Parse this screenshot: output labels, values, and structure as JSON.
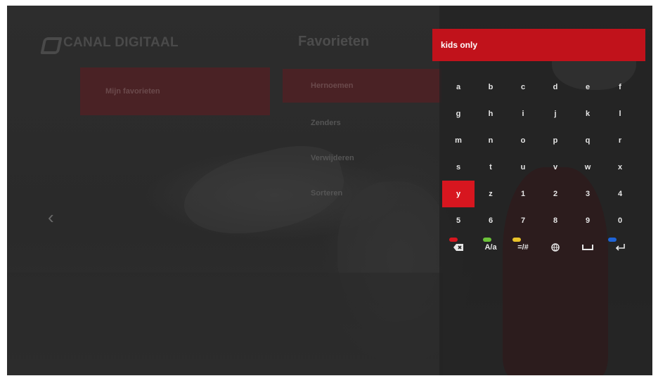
{
  "brand": {
    "name": "CANAL DIGITAAL"
  },
  "sidebar": {
    "items": [
      {
        "label": "Mijn favorieten"
      }
    ]
  },
  "section": {
    "title": "Favorieten"
  },
  "menu": {
    "items": [
      {
        "label": "Hernoemen",
        "active": true
      },
      {
        "label": "Zenders"
      },
      {
        "label": "Verwijderen"
      },
      {
        "label": "Sorteren"
      }
    ]
  },
  "nav": {
    "back": "‹"
  },
  "keyboard": {
    "input_value": "kids only",
    "selected_key": "y",
    "rows": [
      [
        "a",
        "b",
        "c",
        "d",
        "e",
        "f"
      ],
      [
        "g",
        "h",
        "i",
        "j",
        "k",
        "l"
      ],
      [
        "m",
        "n",
        "o",
        "p",
        "q",
        "r"
      ],
      [
        "s",
        "t",
        "u",
        "v",
        "w",
        "x"
      ],
      [
        "y",
        "z",
        "1",
        "2",
        "3",
        "4"
      ],
      [
        "5",
        "6",
        "7",
        "8",
        "9",
        "0"
      ]
    ],
    "function_keys": [
      {
        "name": "backspace",
        "icon": "backspace-icon",
        "hint": "red"
      },
      {
        "name": "case",
        "label": "A/a",
        "hint": "green"
      },
      {
        "name": "symbols",
        "label": "=/#",
        "hint": "yellow"
      },
      {
        "name": "language",
        "icon": "globe-icon"
      },
      {
        "name": "space",
        "icon": "space-icon"
      },
      {
        "name": "enter",
        "icon": "enter-icon",
        "hint": "blue"
      }
    ]
  },
  "colors": {
    "accent": "#d7161f",
    "input_bg": "#c1121b",
    "dim_red": "#4a2225"
  }
}
